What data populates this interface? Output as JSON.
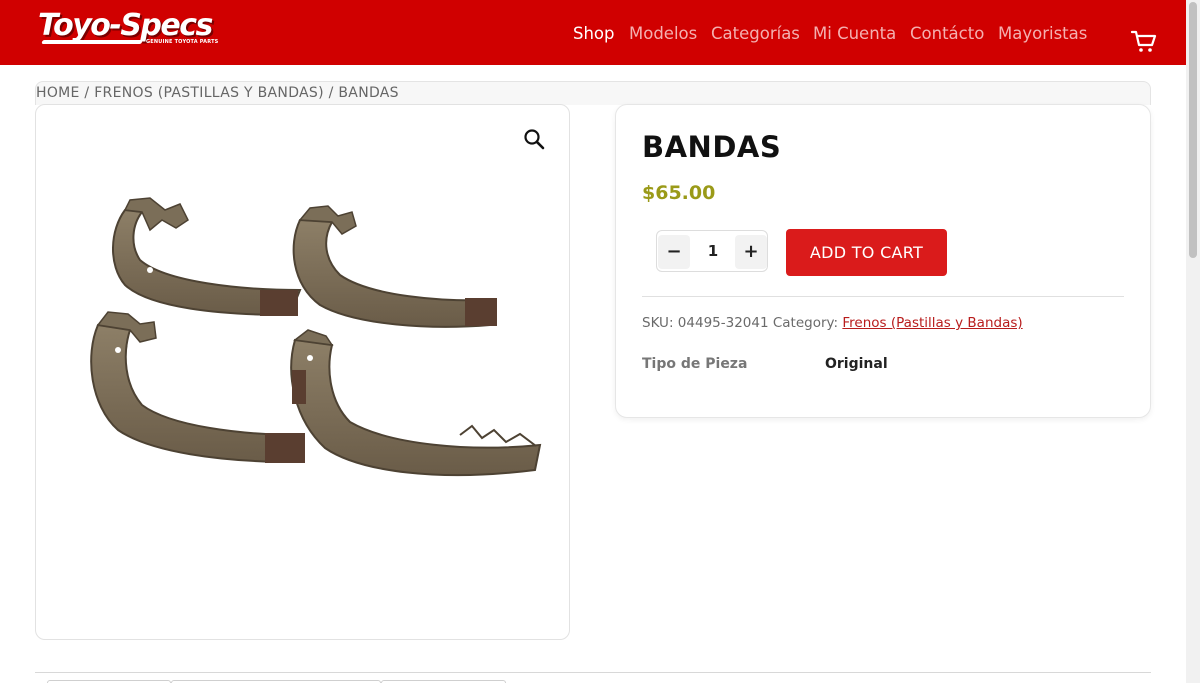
{
  "brand": {
    "logo_text": "Toyo-Specs",
    "logo_tagline": "GENUINE TOYOTA PARTS"
  },
  "colors": {
    "header_bg": "#d00000",
    "add_to_cart_bg": "#da1b1b",
    "price": "#9a9a18",
    "link": "#b81c1c"
  },
  "nav": {
    "items": [
      {
        "label": "Shop"
      },
      {
        "label": "Modelos"
      },
      {
        "label": "Categorías"
      },
      {
        "label": "Mi Cuenta"
      },
      {
        "label": "Contácto"
      },
      {
        "label": "Mayoristas"
      }
    ],
    "active": "Shop",
    "cart_icon": "cart-icon"
  },
  "breadcrumb": {
    "items": [
      "HOME",
      "FRENOS (PASTILLAS Y BANDAS)",
      "BANDAS"
    ],
    "separator": " / "
  },
  "gallery": {
    "zoom_icon": "magnifier-icon",
    "image_alt": "brake-shoes-image"
  },
  "product": {
    "title": "BANDAS",
    "price": "$65.00",
    "quantity": "1",
    "add_to_cart_label": "ADD TO CART",
    "sku_label": "SKU:",
    "sku": "04495-32041",
    "category_label": "Category:",
    "category": "Frenos (Pastillas y Bandas)",
    "attributes": [
      {
        "label": "Tipo de Pieza",
        "value": "Original"
      }
    ]
  }
}
